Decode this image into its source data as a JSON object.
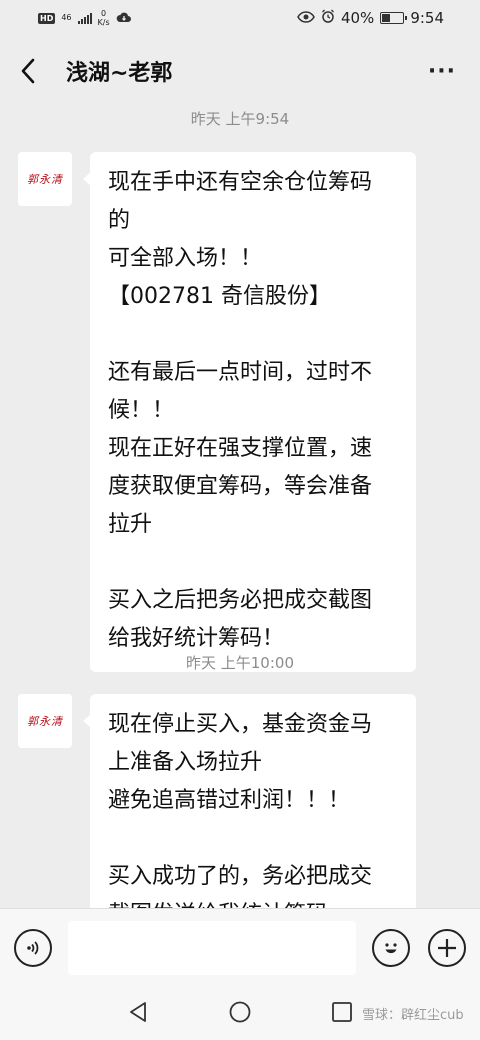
{
  "status_bar": {
    "hd": "HD",
    "network": "46",
    "net_speed_value": "0",
    "net_speed_unit": "K/s",
    "battery_percent": "40%",
    "battery_level": 0.4,
    "time": "9:54"
  },
  "header": {
    "title": "浅湖~老郭",
    "more": "···"
  },
  "avatar": {
    "seal_text": "郭永清"
  },
  "messages": [
    {
      "timestamp": "昨天 上午9:54",
      "lines": [
        "现在手中还有空余仓位筹码",
        "的",
        "可全部入场！！",
        "【002781 奇信股份】",
        "",
        "还有最后一点时间，过时不",
        "候！！",
        "现在正好在强支撑位置，速",
        "度获取便宜筹码，等会准备",
        "拉升",
        "",
        "买入之后把务必把成交截图",
        "给我好统计筹码！"
      ]
    },
    {
      "timestamp": "昨天 上午10:00",
      "lines": [
        "现在停止买入，基金资金马",
        "上准备入场拉升",
        "避免追高错过利润！！！",
        "",
        "买入成功了的，务必把成交",
        "截图发送给我统计筹码"
      ]
    }
  ],
  "input_bar": {
    "voice_icon": "voice-icon",
    "emoji_icon": "emoji-icon",
    "plus_icon": "plus-icon",
    "placeholder": ""
  },
  "nav": {
    "watermark": "雪球：辟红尘cub"
  }
}
